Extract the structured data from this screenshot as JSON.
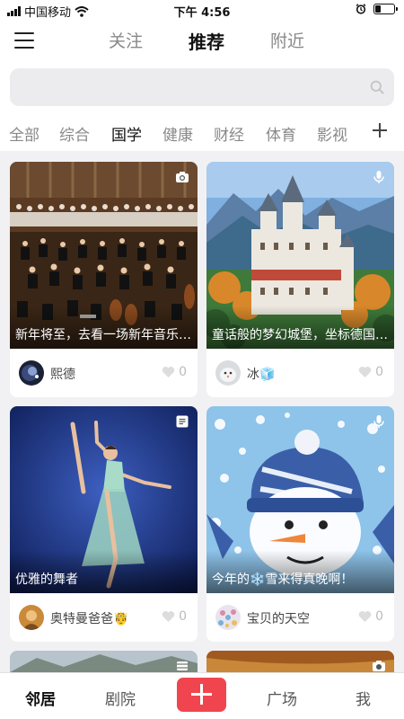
{
  "status_bar": {
    "carrier": "中国移动",
    "time": "下午 4:56",
    "battery_level": 0.3
  },
  "top_nav": {
    "tabs": [
      {
        "label": "关注",
        "active": false
      },
      {
        "label": "推荐",
        "active": true
      },
      {
        "label": "附近",
        "active": false
      }
    ]
  },
  "search": {
    "placeholder": "",
    "value": ""
  },
  "categories": [
    {
      "label": "全部",
      "active": false
    },
    {
      "label": "综合",
      "active": false
    },
    {
      "label": "国学",
      "active": true
    },
    {
      "label": "健康",
      "active": false
    },
    {
      "label": "财经",
      "active": false
    },
    {
      "label": "体育",
      "active": false
    },
    {
      "label": "影视",
      "active": false
    }
  ],
  "posts": [
    {
      "title": "新年将至，去看一场新年音乐会吧",
      "author": "熙德",
      "likes": "0",
      "media": "camera-icon"
    },
    {
      "title": "童话般的梦幻城堡，坐标德国新天鹅堡",
      "author": "冰🧊",
      "likes": "0",
      "media": "microphone-icon"
    },
    {
      "title": "优雅的舞者",
      "author": "奥特曼爸爸🤴",
      "likes": "0",
      "media": "article-icon"
    },
    {
      "title": "今年的❄️雪来得真晚啊！",
      "author": "宝贝的天空",
      "likes": "0",
      "media": "microphone-icon"
    }
  ],
  "bottom_nav": {
    "items": [
      {
        "label": "邻居",
        "active": true
      },
      {
        "label": "剧院",
        "active": false
      },
      {
        "label": "广场",
        "active": false
      },
      {
        "label": "我",
        "active": false
      }
    ],
    "publish_icon": "plus-icon",
    "accent": "#f0454f"
  }
}
